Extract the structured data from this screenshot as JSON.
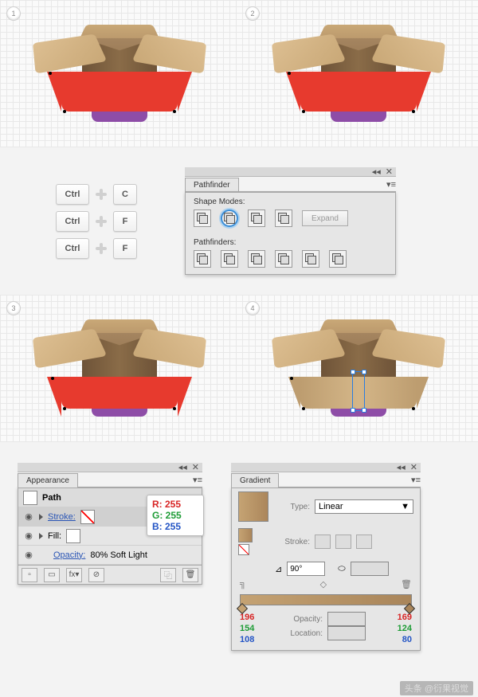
{
  "steps": {
    "s1": "1",
    "s2": "2",
    "s3": "3",
    "s4": "4"
  },
  "shortcuts": {
    "rows": [
      {
        "mod": "Ctrl",
        "key": "C"
      },
      {
        "mod": "Ctrl",
        "key": "F"
      },
      {
        "mod": "Ctrl",
        "key": "F"
      }
    ]
  },
  "pathfinder": {
    "title": "Pathfinder",
    "shape_modes": "Shape Modes:",
    "pathfinders": "Pathfinders:",
    "expand": "Expand"
  },
  "appearance": {
    "title": "Appearance",
    "path": "Path",
    "stroke": "Stroke:",
    "fill": "Fill:",
    "opacity_label": "Opacity:",
    "opacity_value": "80% Soft Light",
    "rgb": {
      "r": "R: 255",
      "g": "G: 255",
      "b": "B: 255"
    },
    "fx": "fx▾"
  },
  "gradient": {
    "title": "Gradient",
    "type_label": "Type:",
    "type_value": "Linear",
    "stroke": "Stroke:",
    "angle": "90°",
    "ratio": "",
    "opacity": "Opacity:",
    "location": "Location:",
    "left": {
      "r": "196",
      "g": "154",
      "b": "108"
    },
    "right": {
      "r": "169",
      "g": "124",
      "b": "80"
    }
  },
  "watermark": "头条 @衍果视觉"
}
